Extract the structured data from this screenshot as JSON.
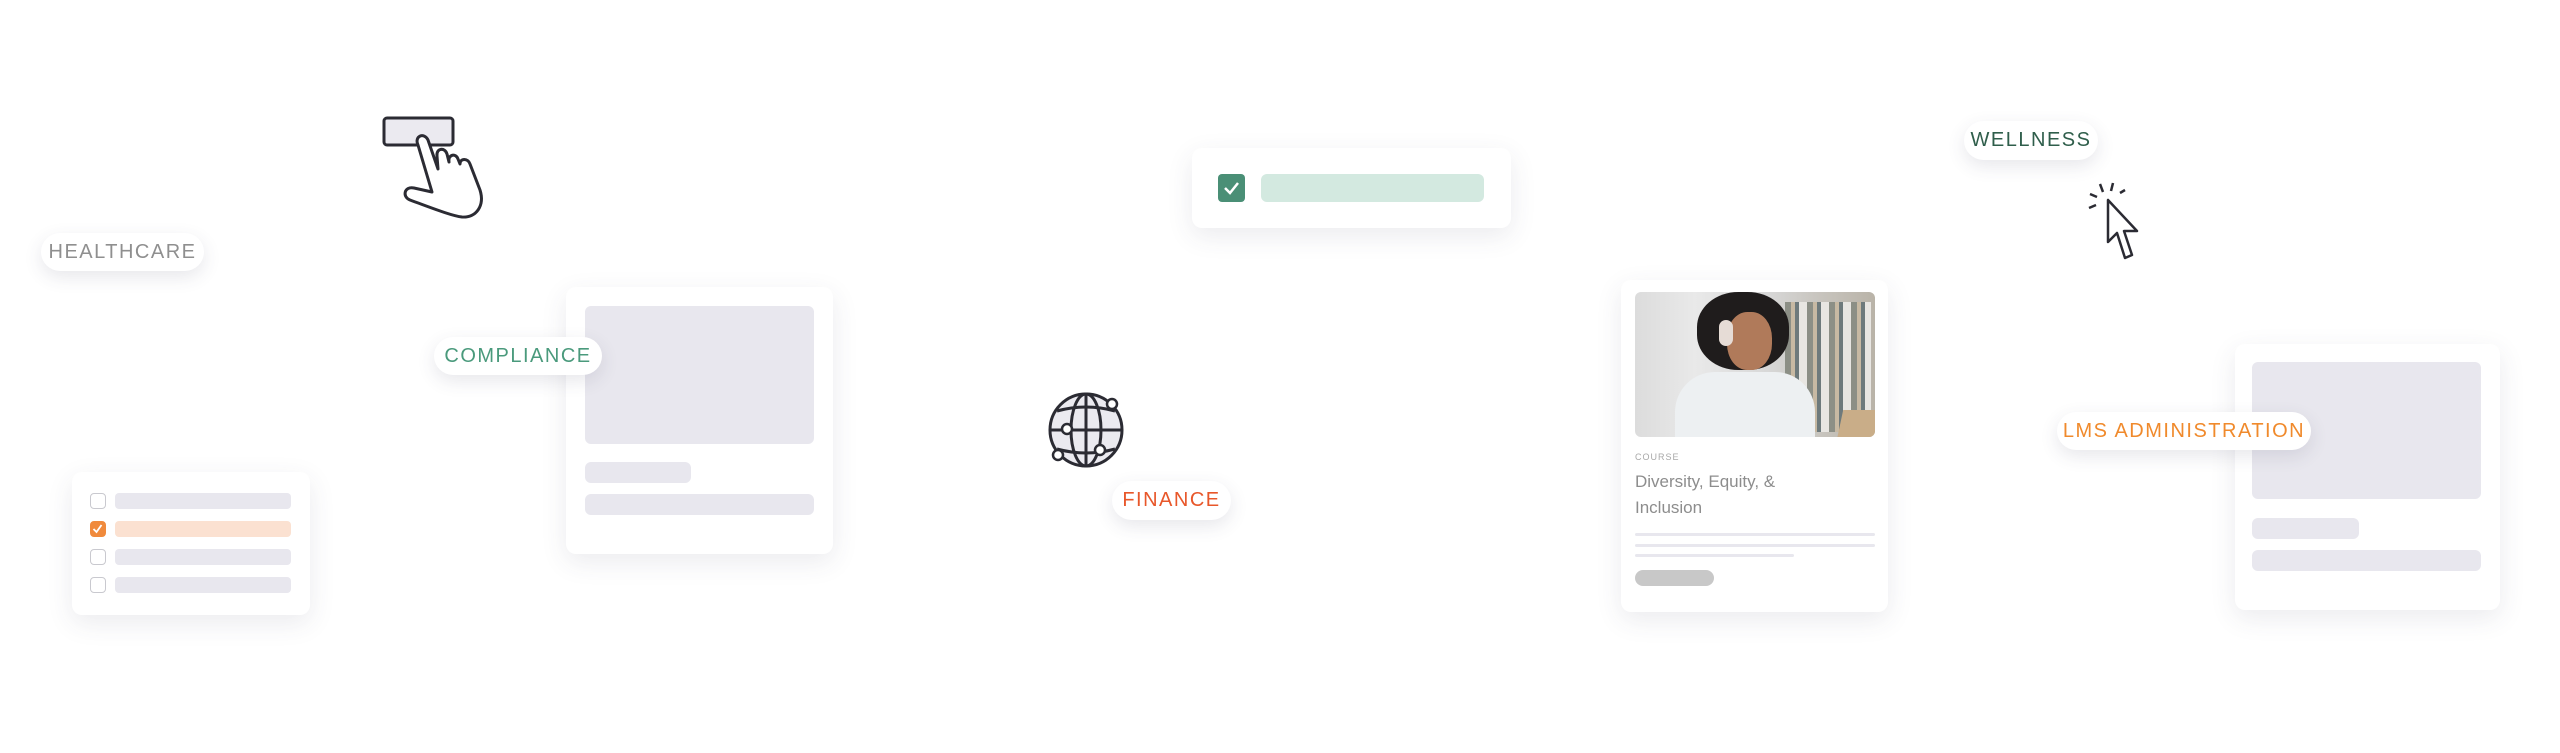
{
  "tags": {
    "healthcare": "HEALTHCARE",
    "compliance": "COMPLIANCE",
    "finance": "FINANCE",
    "wellness": "WELLNESS",
    "lms_administration": "LMS ADMINISTRATION"
  },
  "course_card": {
    "eyebrow": "COURSE",
    "title_line1": "Diversity, Equity, &",
    "title_line2": "Inclusion"
  },
  "checklist": {
    "items": [
      {
        "checked": false
      },
      {
        "checked": true
      },
      {
        "checked": false
      },
      {
        "checked": false
      }
    ]
  },
  "icons": [
    "hand-pointer-icon",
    "globe-network-icon",
    "cursor-click-icon",
    "checkbox-checked-icon"
  ],
  "colors": {
    "healthcare": "#8f8f8f",
    "compliance": "#4a9a7c",
    "finance": "#e8572a",
    "wellness": "#2f5e4b",
    "lms_administration": "#f08a2c",
    "placeholder": "#e8e7ee",
    "accent_green": "#4a8f76",
    "accent_orange": "#f08a3c"
  }
}
